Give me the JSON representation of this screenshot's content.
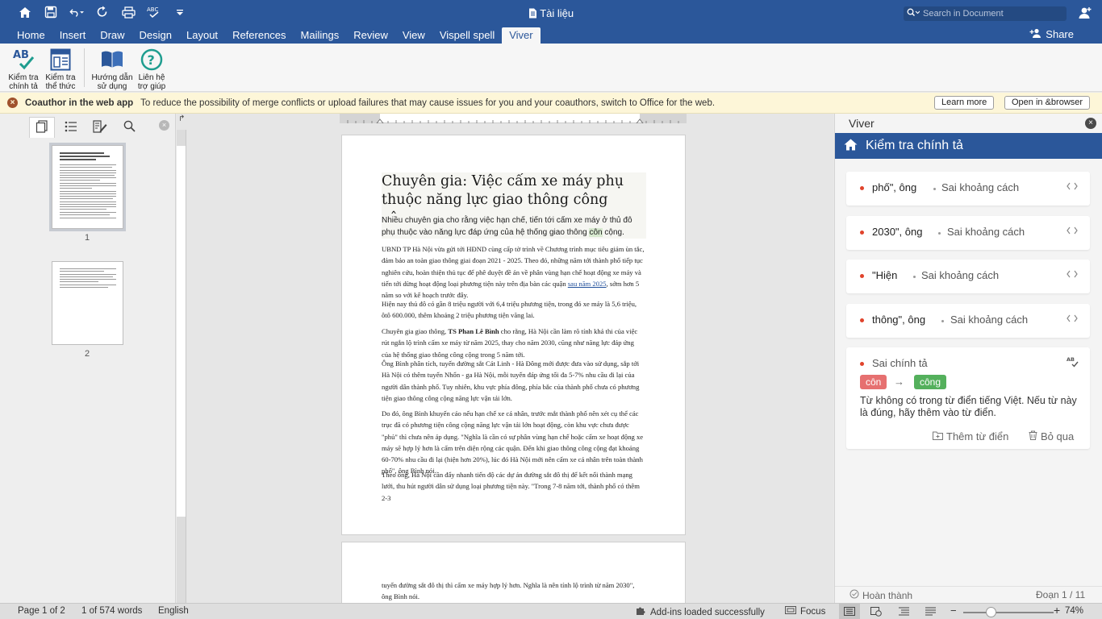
{
  "window": {
    "title": "Tài liệu",
    "search_placeholder": "Search in Document"
  },
  "tabs": [
    "Home",
    "Insert",
    "Draw",
    "Design",
    "Layout",
    "References",
    "Mailings",
    "Review",
    "View",
    "Vispell spell",
    "Viver"
  ],
  "active_tab": "Viver",
  "share_label": "Share",
  "ribbon": {
    "check_spelling": [
      "Kiểm tra",
      "chính tả"
    ],
    "check_format": [
      "Kiểm tra",
      "thể thức"
    ],
    "guide": [
      "Hướng dẫn",
      "sử dụng"
    ],
    "contact": [
      "Liên hệ",
      "trợ giúp"
    ]
  },
  "message_bar": {
    "title": "Coauthor in the web app",
    "text": "To reduce the possibility of merge conflicts or upload failures that may cause issues for you and your coauthors, switch to Office for the web.",
    "learn_more": "Learn more",
    "open_browser": "Open in &browser"
  },
  "nav": {
    "page_numbers": [
      "1",
      "2"
    ]
  },
  "document": {
    "title": "Chuyên gia: Việc cấm xe máy phụ thuộc năng lực giao thông công cộng",
    "lead_before": "Nhiều chuyên gia cho rằng việc hạn chế, tiến tới cấm xe máy ở thủ đô phụ thuộc vào năng lực đáp ứng của hệ thống giao thông ",
    "lead_highlight": "côn",
    "lead_after": " cộng.",
    "p1_before": "UBND TP Hà Nội vừa gửi tới HĐND cùng cấp tờ trình về Chương trình mục tiêu giảm ùn tắc, đảm bảo an toàn giao thông giai đoạn 2021 - 2025. Theo đó, những năm tới thành phố tiếp tục nghiên cứu, hoàn thiện thủ tục để phê duyệt đề án về phân vùng hạn chế hoạt động xe máy và tiến tới dừng hoạt động loại phương tiện này trên địa bàn các quận ",
    "p1_link": "sau năm 2025",
    "p1_after": ", sớm hơn 5 năm so với kế hoạch trước đây.",
    "p2": "Hiện nay thủ đô có gần 8 triệu người với 6,4 triệu phương tiện, trong đó xe máy là 5,6 triệu, ôtô 600.000, thêm khoảng 2 triệu phương tiện vãng lai.",
    "p3_before": "Chuyên gia giao thông, ",
    "p3_bold": "TS Phan Lê Bình",
    "p3_after": " cho rằng, Hà Nội cần làm rõ tính khả thi của việc rút ngắn lộ trình cấm xe máy từ năm 2025, thay cho năm 2030, cũng như năng lực đáp ứng của hệ thống giao thông công cộng trong 5 năm tới.",
    "p4": "Ông Bình phân tích, tuyến đường sắt Cát Linh - Hà Đông mới được đưa vào sử dụng, sắp tới Hà Nội có thêm tuyến Nhổn - ga Hà Nội, mỗi tuyến đáp ứng tối đa 5-7% nhu cầu đi lại của người dân thành phố. Tuy nhiên, khu vực phía đông, phía bắc của thành phố chưa có phương tiện giao thông công cộng năng lực vận tải lớn.",
    "p5": "Do đó, ông Bình khuyến cáo nếu hạn chế xe cá nhân, trước mắt thành phố nên xét cụ thể các trục đã có phương tiện công cộng năng lực vận tải lớn hoạt động, còn khu vực chưa được \"phủ\" thì chưa nên áp dụng. \"Nghĩa là cần có sự phân vùng hạn chế hoặc cấm xe hoạt động xe máy sẽ hợp lý hơn là cấm trên diện rộng các quận. Đến khi giao thông công cộng đạt khoảng 60-70% nhu cầu đi lại (hiện hơn 20%), lúc đó Hà Nội mới nên cấm xe cá nhân trên toàn thành phố\", ông Bình nói.",
    "p6": "Theo ông, Hà Nội cần đẩy nhanh tiến độ các dự án đường sắt đô thị để kết nối thành mạng lưới, thu hút người dân sử dụng loại phương tiện này. \"Trong 7-8 năm tới, thành phố có thêm 2-3",
    "p7": "tuyến đường sắt đô thị thì cấm xe máy hợp lý hơn. Nghĩa là nên tính lộ trình từ năm 2030\", ông Bình nói."
  },
  "pane": {
    "header": "Viver",
    "section_title": "Kiểm tra chính tả",
    "issues": [
      {
        "word": "phố\", ông",
        "type": "Sai khoảng cách"
      },
      {
        "word": "2030\", ông",
        "type": "Sai khoảng cách"
      },
      {
        "word": "\"Hiện",
        "type": "Sai khoảng cách"
      },
      {
        "word": "thông\", ông",
        "type": "Sai khoảng cách"
      }
    ],
    "spell_card": {
      "title": "Sai chính tả",
      "wrong": "côn",
      "suggestion": "công",
      "description": "Từ không có trong từ điển tiếng Việt. Nếu từ này là đúng, hãy thêm vào từ điển.",
      "add_label": "Thêm từ điển",
      "ignore_label": "Bỏ qua"
    },
    "footer_done": "Hoàn thành",
    "footer_paragraph": "Đoạn 1 / 11"
  },
  "status": {
    "page": "Page 1 of 2",
    "words": "1 of 574 words",
    "language": "English",
    "addins": "Add-ins loaded successfully",
    "focus": "Focus",
    "zoom": "74%"
  },
  "colors": {
    "accent": "#2b579a",
    "error_dot": "#e0432b",
    "wrong_tag": "#e67070",
    "right_tag": "#54b05c"
  }
}
